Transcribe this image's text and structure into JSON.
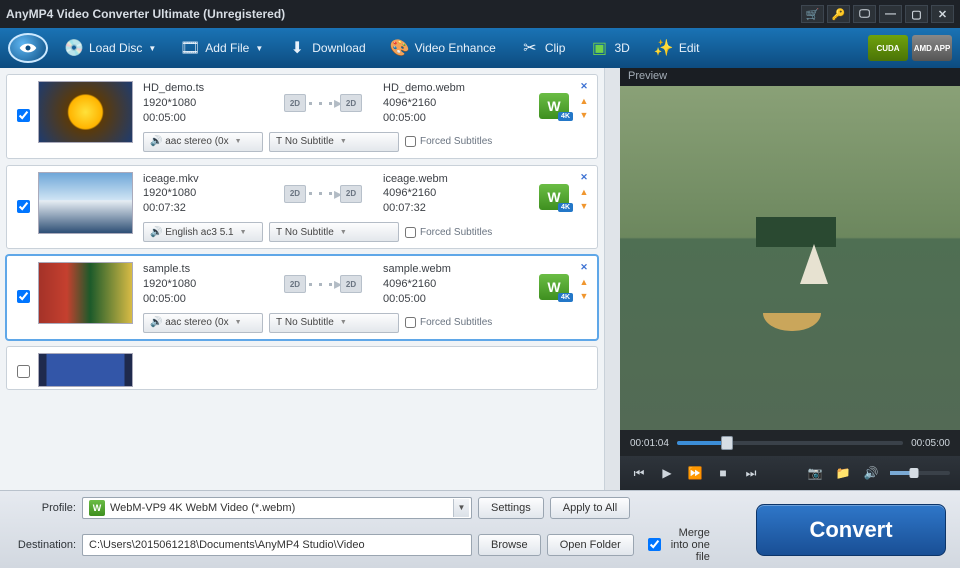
{
  "title": "AnyMP4 Video Converter Ultimate (Unregistered)",
  "toolbar": {
    "load_disc": "Load Disc",
    "add_file": "Add File",
    "download": "Download",
    "enhance": "Video Enhance",
    "clip": "Clip",
    "three_d": "3D",
    "edit": "Edit"
  },
  "badges": {
    "cuda": "CUDA",
    "amd": "AMD APP"
  },
  "list": [
    {
      "src_name": "HD_demo.ts",
      "src_res": "1920*1080",
      "src_dur": "00:05:00",
      "dst_name": "HD_demo.webm",
      "dst_res": "4096*2160",
      "dst_dur": "00:05:00",
      "audio": "aac stereo (0x",
      "sub": "No Subtitle",
      "forced": "Forced Subtitles"
    },
    {
      "src_name": "iceage.mkv",
      "src_res": "1920*1080",
      "src_dur": "00:07:32",
      "dst_name": "iceage.webm",
      "dst_res": "4096*2160",
      "dst_dur": "00:07:32",
      "audio": "English ac3 5.1",
      "sub": "No Subtitle",
      "forced": "Forced Subtitles"
    },
    {
      "src_name": "sample.ts",
      "src_res": "1920*1080",
      "src_dur": "00:05:00",
      "dst_name": "sample.webm",
      "dst_res": "4096*2160",
      "dst_dur": "00:05:00",
      "audio": "aac stereo (0x",
      "sub": "No Subtitle",
      "forced": "Forced Subtitles"
    }
  ],
  "arrow_2d": "2D",
  "preview": {
    "label": "Preview",
    "current": "00:01:04",
    "total": "00:05:00"
  },
  "bottom": {
    "profile_lbl": "Profile:",
    "profile_val": "WebM-VP9 4K WebM Video (*.webm)",
    "settings": "Settings",
    "apply_all": "Apply to All",
    "dest_lbl": "Destination:",
    "dest_val": "C:\\Users\\2015061218\\Documents\\AnyMP4 Studio\\Video",
    "browse": "Browse",
    "open_folder": "Open Folder",
    "merge": "Merge into one file",
    "convert": "Convert"
  }
}
